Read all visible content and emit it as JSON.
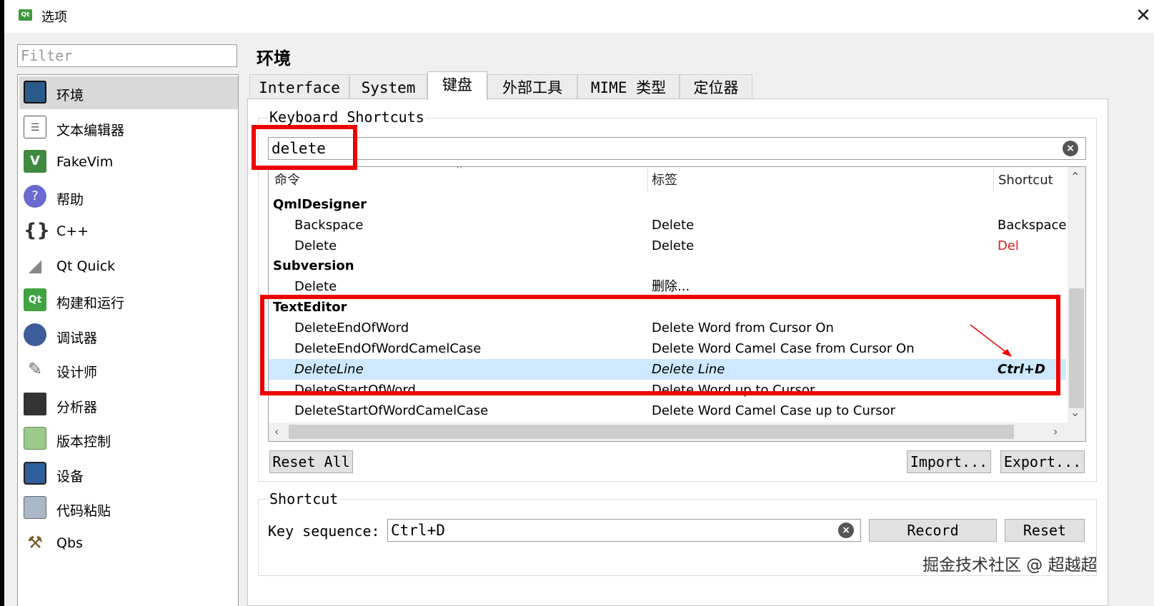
{
  "window": {
    "title": "选项",
    "app_icon": "qt-creator-icon",
    "close_icon": "close-icon"
  },
  "sidebar": {
    "filter_placeholder": "Filter",
    "items": [
      {
        "label": "环境",
        "icon": "monitor-icon",
        "color": "#2b5a8a"
      },
      {
        "label": "文本编辑器",
        "icon": "text-document-icon",
        "color": "#ffffff"
      },
      {
        "label": "FakeVim",
        "icon": "vim-icon",
        "color": "#3f8a3f"
      },
      {
        "label": "帮助",
        "icon": "help-icon",
        "color": "#6a6ad0"
      },
      {
        "label": "C++",
        "icon": "braces-icon",
        "color": "#ffffff"
      },
      {
        "label": "Qt Quick",
        "icon": "paper-plane-icon",
        "color": "#ffffff"
      },
      {
        "label": "构建和运行",
        "icon": "qt-build-icon",
        "color": "#41a341"
      },
      {
        "label": "调试器",
        "icon": "debugger-bug-icon",
        "color": "#3d5c9a"
      },
      {
        "label": "设计师",
        "icon": "designer-icon",
        "color": "#ffffff"
      },
      {
        "label": "分析器",
        "icon": "analyzer-icon",
        "color": "#333333"
      },
      {
        "label": "版本控制",
        "icon": "version-control-icon",
        "color": "#9bc98a"
      },
      {
        "label": "设备",
        "icon": "device-icon",
        "color": "#2f5f9c"
      },
      {
        "label": "代码粘贴",
        "icon": "code-paste-icon",
        "color": "#aab8c8"
      },
      {
        "label": "Qbs",
        "icon": "hammer-icon",
        "color": "#ffffff"
      }
    ]
  },
  "page": {
    "title": "环境",
    "tabs": [
      "Interface",
      "System",
      "键盘",
      "外部工具",
      "MIME 类型",
      "定位器"
    ],
    "active_tab": "键盘"
  },
  "keyboard_shortcuts": {
    "group_title": "Keyboard Shortcuts",
    "search_value": "delete",
    "columns": [
      "命令",
      "标签",
      "Shortcut"
    ],
    "rows": [
      {
        "type": "group",
        "command": "QmlDesigner",
        "label": "",
        "shortcut": ""
      },
      {
        "type": "item",
        "command": "Backspace",
        "label": "Delete",
        "shortcut": "Backspace"
      },
      {
        "type": "item",
        "command": "Delete",
        "label": "Delete",
        "shortcut": "Del",
        "modified": true
      },
      {
        "type": "group",
        "command": "Subversion",
        "label": "",
        "shortcut": ""
      },
      {
        "type": "item",
        "command": "Delete",
        "label": "删除...",
        "shortcut": ""
      },
      {
        "type": "group",
        "command": "TextEditor",
        "label": "",
        "shortcut": ""
      },
      {
        "type": "item",
        "command": "DeleteEndOfWord",
        "label": "Delete Word from Cursor On",
        "shortcut": ""
      },
      {
        "type": "item",
        "command": "DeleteEndOfWordCamelCase",
        "label": "Delete Word Camel Case from Cursor On",
        "shortcut": ""
      },
      {
        "type": "item",
        "command": "DeleteLine",
        "label": "Delete Line",
        "shortcut": "Ctrl+D",
        "selected": true
      },
      {
        "type": "item",
        "command": "DeleteStartOfWord",
        "label": "Delete Word up to Cursor",
        "shortcut": ""
      },
      {
        "type": "item",
        "command": "DeleteStartOfWordCamelCase",
        "label": "Delete Word Camel Case up to Cursor",
        "shortcut": ""
      }
    ],
    "buttons": {
      "reset_all": "Reset All",
      "import": "Import...",
      "export": "Export..."
    }
  },
  "shortcut_group": {
    "title": "Shortcut",
    "key_sequence_label": "Key sequence:",
    "key_sequence_value": "Ctrl+D",
    "record_label": "Record",
    "reset_label": "Reset"
  },
  "colors": {
    "highlight": "#ee0000",
    "selected_row": "#cde8ff",
    "modified_shortcut": "#e02020"
  },
  "watermark": "掘金技术社区 @ 超越超"
}
